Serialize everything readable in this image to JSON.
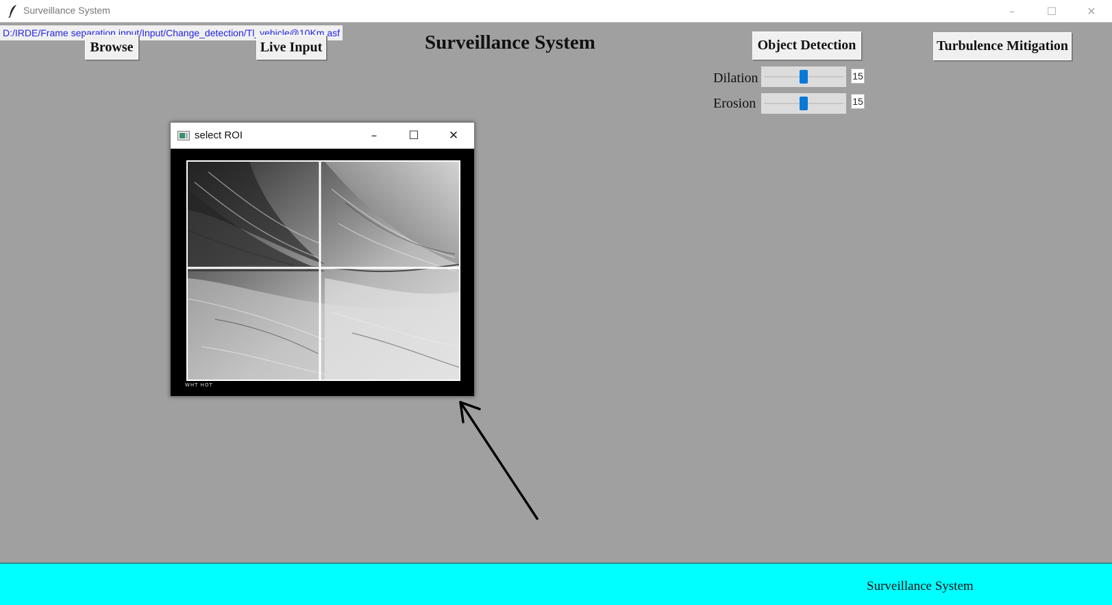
{
  "window": {
    "title": "Surveillance System",
    "icon": "feather-icon",
    "controls": {
      "minimize": "–",
      "maximize": "☐",
      "close": "✕"
    }
  },
  "file_path": "D:/IRDE/Frame separation input/Input/Change_detection/Tl_vehicle@10Km.asf",
  "toolbar": {
    "browse_label": "Browse",
    "live_input_label": "Live Input",
    "object_detection_label": "Object Detection",
    "turbulence_label": "Turbulence Mitigation"
  },
  "main_title": "Surveillance System",
  "sliders": {
    "dilation": {
      "label": "Dilation",
      "value": "15",
      "min": 0,
      "max": 30
    },
    "erosion": {
      "label": "Erosion",
      "value": "15",
      "min": 0,
      "max": 30
    }
  },
  "roi_window": {
    "title": "select ROI",
    "controls": {
      "minimize": "–",
      "maximize": "☐",
      "close": "✕"
    },
    "footer_text": "WHT  HOT"
  },
  "status_bar": {
    "text": "Surveillance System"
  },
  "colors": {
    "background": "#a0a0a0",
    "status_bar": "#00ffff",
    "path_text": "#2323e6",
    "slider_thumb": "#0a78d7"
  }
}
